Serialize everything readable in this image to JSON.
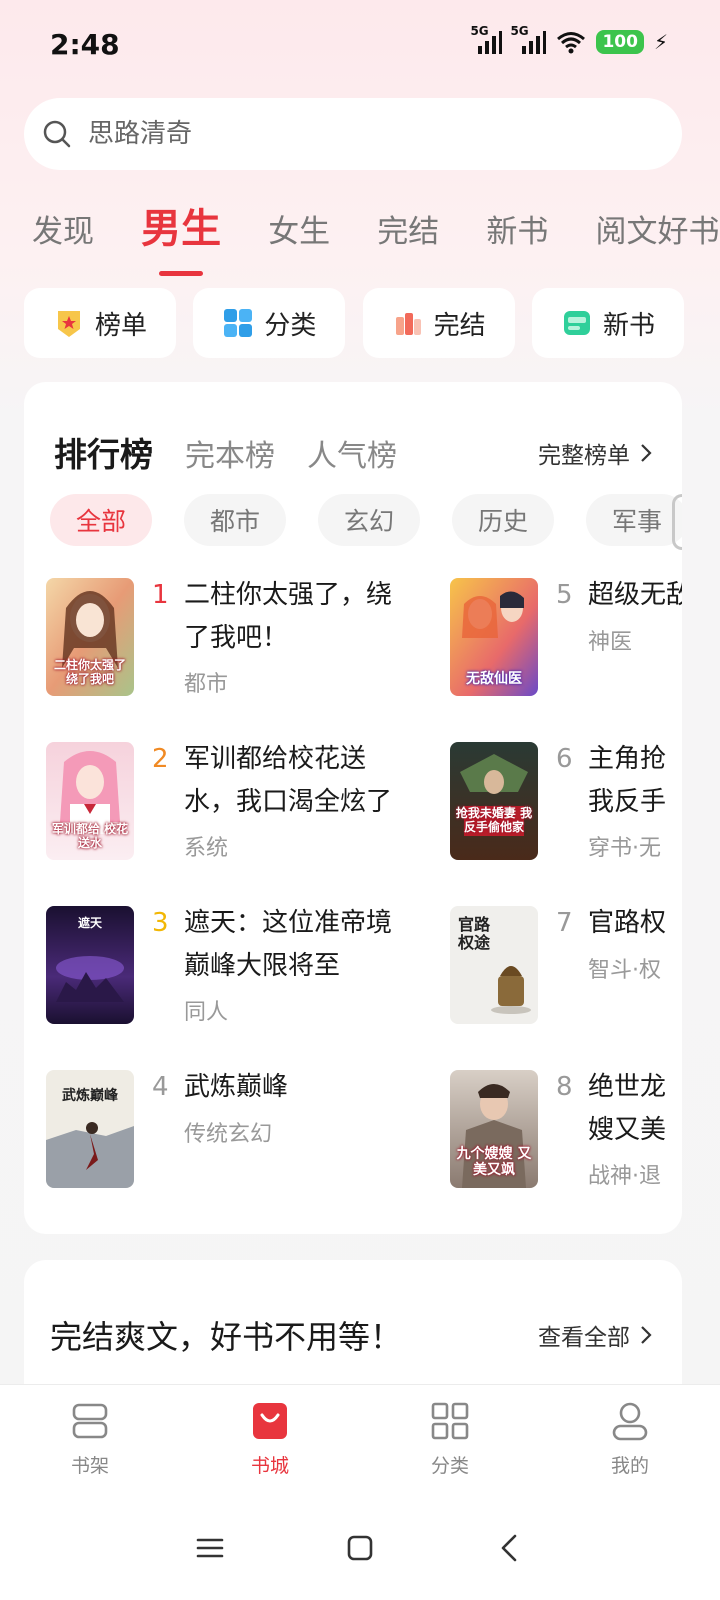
{
  "status_bar": {
    "time": "2:48",
    "signal1_label": "5G",
    "signal2_label": "5G",
    "battery": "100"
  },
  "search": {
    "placeholder": "思路清奇"
  },
  "channel_tabs": [
    "发现",
    "男生",
    "女生",
    "完结",
    "新书",
    "阅文好书"
  ],
  "channel_active": "男生",
  "quick_entries": [
    {
      "label": "榜单",
      "icon": "medal-icon"
    },
    {
      "label": "分类",
      "icon": "grid-icon"
    },
    {
      "label": "完结",
      "icon": "books-icon"
    },
    {
      "label": "新书",
      "icon": "new-badge-icon"
    }
  ],
  "ranking": {
    "tabs": [
      "排行榜",
      "完本榜",
      "人气榜"
    ],
    "more_label": "完整榜单",
    "genres": [
      "全部",
      "都市",
      "玄幻",
      "历史",
      "军事"
    ],
    "books": [
      {
        "rank": "1",
        "title": "二柱你太强了，绕了我吧！",
        "tag": "都市",
        "cover_text": "二柱你太强了 绕了我吧",
        "rank_color": "#e8353e"
      },
      {
        "rank": "2",
        "title": "军训都给校花送水，我口渴全炫了",
        "tag": "系统",
        "cover_text": "军训都给 校花送水",
        "rank_color": "#f08a24"
      },
      {
        "rank": "3",
        "title": "遮天：这位准帝境巅峰大限将至",
        "tag": "同人",
        "cover_text": "遮天",
        "rank_color": "#f2b705"
      },
      {
        "rank": "4",
        "title": "武炼巅峰",
        "tag": "传统玄幻",
        "cover_text": "武炼巅峰",
        "rank_color": "#999999"
      },
      {
        "rank": "5",
        "title": "超级无敌",
        "tag": "神医",
        "cover_text": "无敌仙医",
        "rank_color": "#999999"
      },
      {
        "rank": "6",
        "title": "主角抢我反手",
        "tag": "穿书·无",
        "cover_text": "抢我未婚妻 我反手偷他家",
        "rank_color": "#999999"
      },
      {
        "rank": "7",
        "title": "官路权",
        "tag": "智斗·权",
        "cover_text": "官路权途",
        "rank_color": "#999999"
      },
      {
        "rank": "8",
        "title": "绝世龙嫂又美",
        "tag": "战神·退",
        "cover_text": "九个嫂嫂 又美又飒",
        "rank_color": "#999999"
      }
    ]
  },
  "complete_section": {
    "title": "完结爽文，好书不用等！",
    "more_label": "查看全部"
  },
  "bottom_nav": [
    {
      "label": "书架",
      "icon": "bookshelf-icon"
    },
    {
      "label": "书城",
      "icon": "bookstore-bag-icon"
    },
    {
      "label": "分类",
      "icon": "category-grid-icon"
    },
    {
      "label": "我的",
      "icon": "profile-icon"
    }
  ],
  "bottom_nav_active": "书城",
  "colors": {
    "accent": "#e8353e",
    "accent_soft": "#fde8ea",
    "battery": "#3cc44c"
  }
}
